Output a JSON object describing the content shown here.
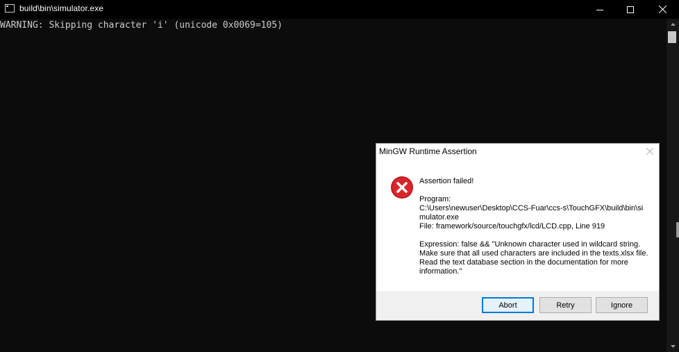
{
  "window": {
    "title": "build\\bin\\simulator.exe",
    "icons": {
      "app": "console-window-icon",
      "minimize": "minimize-icon",
      "maximize": "maximize-icon",
      "close": "close-icon"
    }
  },
  "console": {
    "lines": [
      "WARNING: Skipping character 'i' (unicode 0x0069=105)"
    ]
  },
  "dialog": {
    "title": "MinGW Runtime Assertion",
    "icon": "error-icon",
    "heading": "Assertion failed!",
    "program_label": "Program:",
    "program_path": "C:\\Users\\newuser\\Desktop\\CCS-Fuar\\ccs-s\\TouchGFX\\build\\bin\\simulator.exe",
    "file_line": "File: framework/source/touchgfx/lcd/LCD.cpp, Line 919",
    "expression": "Expression: false && \"Unknown character used in wildcard string. Make sure that all used characters are included in the texts.xlsx file. Read the text database section in the documentation for more information.\"",
    "buttons": {
      "abort": "Abort",
      "retry": "Retry",
      "ignore": "Ignore"
    }
  },
  "colors": {
    "console_bg": "#0c0c0c",
    "console_text": "#cccccc",
    "error_red": "#d9262b",
    "focus_blue": "#0078d7"
  }
}
